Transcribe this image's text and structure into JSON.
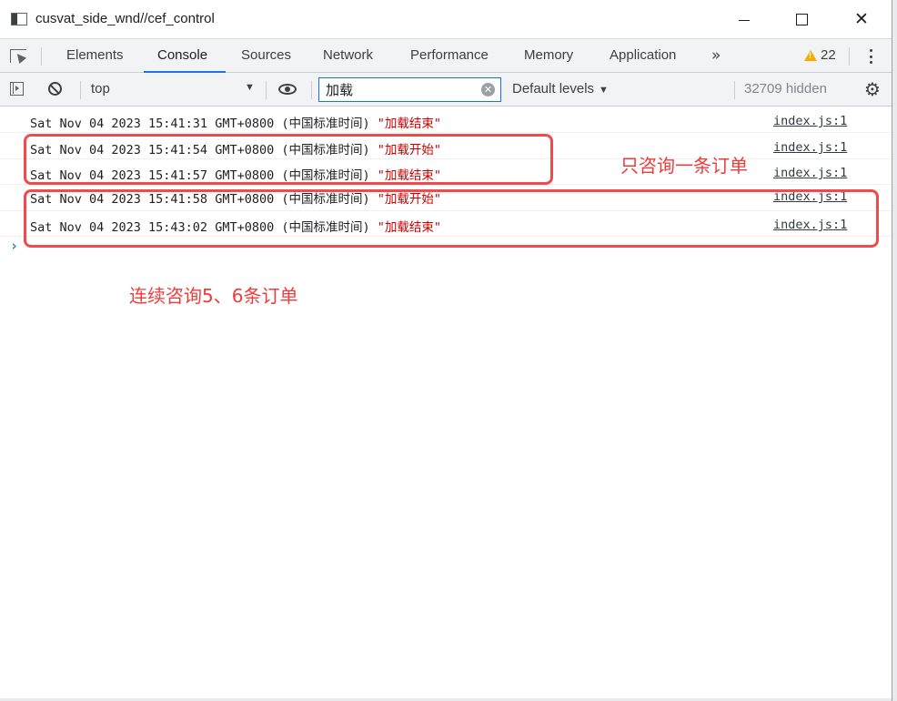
{
  "window": {
    "title": "cusvat_side_wnd//cef_control",
    "minimize_icon": "minimize-icon",
    "maximize_icon": "maximize-icon",
    "close_icon": "close-icon",
    "close_glyph": "✕"
  },
  "tabs": {
    "items": [
      "Elements",
      "Console",
      "Sources",
      "Network",
      "Performance",
      "Memory",
      "Application"
    ],
    "active": "Console",
    "overflow_glyph": "»",
    "warnings_count": "22",
    "accent_color": "#1a73e8"
  },
  "toolbar": {
    "context": "top",
    "caret": "▼",
    "filter_value": "加载",
    "filter_clear_glyph": "✕",
    "levels_label": "Default levels",
    "hidden_label": "32709 hidden",
    "gear_glyph": "⚙"
  },
  "console": {
    "rows": [
      {
        "prefix": "Sat Nov 04 2023 15:41:31 GMT+0800 (中国标准时间) ",
        "value": "\"加载结束\"",
        "source": "index.js:1"
      },
      {
        "prefix": "Sat Nov 04 2023 15:41:54 GMT+0800 (中国标准时间) ",
        "value": "\"加载开始\"",
        "source": "index.js:1"
      },
      {
        "prefix": "Sat Nov 04 2023 15:41:57 GMT+0800 (中国标准时间) ",
        "value": "\"加载结束\"",
        "source": "index.js:1"
      },
      {
        "prefix": "Sat Nov 04 2023 15:41:58 GMT+0800 (中国标准时间) ",
        "value": "\"加载开始\"",
        "source": "index.js:1"
      },
      {
        "prefix": "Sat Nov 04 2023 15:43:02 GMT+0800 (中国标准时间) ",
        "value": "\"加载结束\"",
        "source": "index.js:1"
      }
    ],
    "prompt_glyph": "›",
    "string_color": "#c80000"
  },
  "annotations": {
    "single_order": "只咨询一条订单",
    "multi_order": "连续咨询5、6条订单",
    "color": "#f04a4a"
  }
}
